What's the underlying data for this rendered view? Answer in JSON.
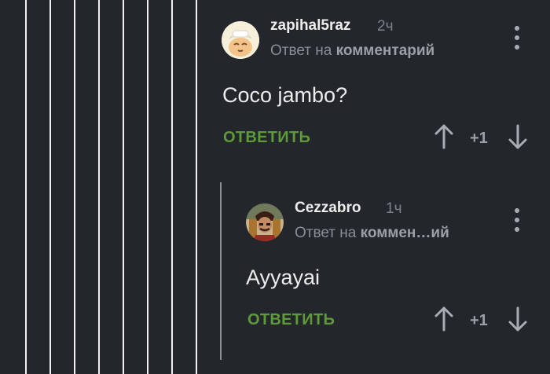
{
  "comments": [
    {
      "username": "zapihal5raz",
      "time": "2ч",
      "reply_prefix": "Ответ на",
      "reply_target": "комментарий",
      "text": "Coco jambo?",
      "reply_label": "ОТВЕТИТЬ",
      "score": "+1",
      "avatar_icon": "cartoon-face-avatar"
    },
    {
      "username": "Cezzabro",
      "time": "1ч",
      "reply_prefix": "Ответ на",
      "reply_target": "коммен…ий",
      "text": "Ayyayai",
      "reply_label": "ОТВЕТИТЬ",
      "score": "+1",
      "avatar_icon": "character-portrait-avatar"
    }
  ],
  "colors": {
    "background": "#23262b",
    "thread_line": "#eef0f2",
    "reply_button": "#5d9a3a",
    "muted_text": "#7e838a"
  }
}
